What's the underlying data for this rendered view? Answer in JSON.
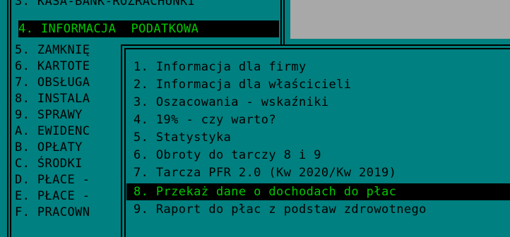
{
  "main_menu": {
    "items": [
      {
        "label": "3. KASA-BANK-ROZRACHUNKI"
      },
      {
        "label": "4. INFORMACJA  PODATKOWA"
      },
      {
        "label": "5. ZAMKNIĘ"
      },
      {
        "label": "6. KARTOTE"
      },
      {
        "label": "7. OBSŁUGA"
      },
      {
        "label": "8. INSTALA"
      },
      {
        "label": "9. SPRAWY "
      },
      {
        "label": "A. EWIDENC"
      },
      {
        "label": "B. OPŁATY "
      },
      {
        "label": "C. ŚRODKI "
      },
      {
        "label": "D. PŁACE -"
      },
      {
        "label": "E. PŁACE -"
      },
      {
        "label": "F. PRACOWN"
      }
    ],
    "selected_index": 1
  },
  "submenu": {
    "items": [
      {
        "label": "1. Informacja dla firmy"
      },
      {
        "label": "2. Informacja dla właścicieli"
      },
      {
        "label": "3. Oszacowania - wskaźniki"
      },
      {
        "label": "4. 19% - czy warto?"
      },
      {
        "label": "5. Statystyka"
      },
      {
        "label": "6. Obroty do tarczy 8 i 9"
      },
      {
        "label": "7. Tarcza PFR 2.0 (Kw 2020/Kw 2019)"
      },
      {
        "label": "8. Przekaż dane o dochodach do płac"
      },
      {
        "label": "9. Raport do płac z podstaw zdrowotnego"
      }
    ],
    "selected_index": 7
  },
  "colors": {
    "background": "#008080",
    "text": "#000000",
    "highlight_bg": "#000000",
    "highlight_text": "#00c800",
    "panel_grey": "#a8a8a8"
  }
}
